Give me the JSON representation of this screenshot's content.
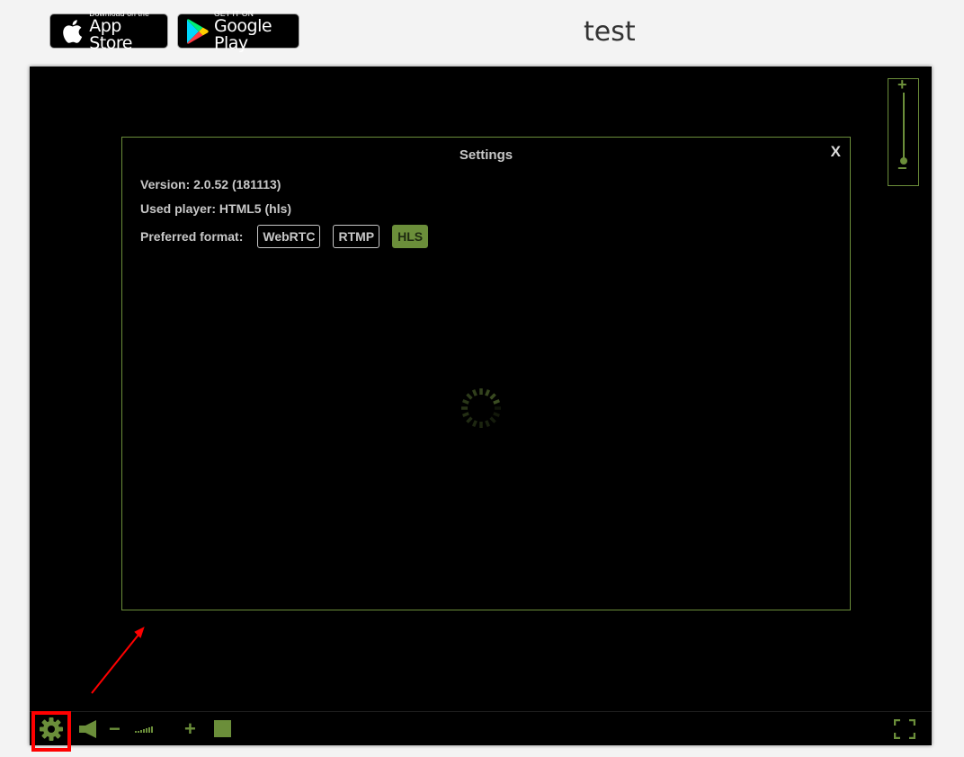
{
  "header": {
    "app_store": {
      "small": "Download on the",
      "big": "App Store"
    },
    "google_play": {
      "small": "GET IT ON",
      "big": "Google Play"
    },
    "title": "test"
  },
  "settings": {
    "title": "Settings",
    "close_label": "X",
    "version": "Version: 2.0.52 (181113)",
    "used_player": "Used player: HTML5 (hls)",
    "preferred_format_label": "Preferred format:",
    "formats": [
      {
        "label": "WebRTC",
        "active": false
      },
      {
        "label": "RTMP",
        "active": false
      },
      {
        "label": "HLS",
        "active": true
      }
    ]
  },
  "zoom": {
    "plus": "+",
    "minus": "−"
  },
  "controls": {
    "volume_minus": "−",
    "volume_plus": "+"
  },
  "colors": {
    "accent": "#6b8e3a",
    "annotation": "#ff0000"
  }
}
